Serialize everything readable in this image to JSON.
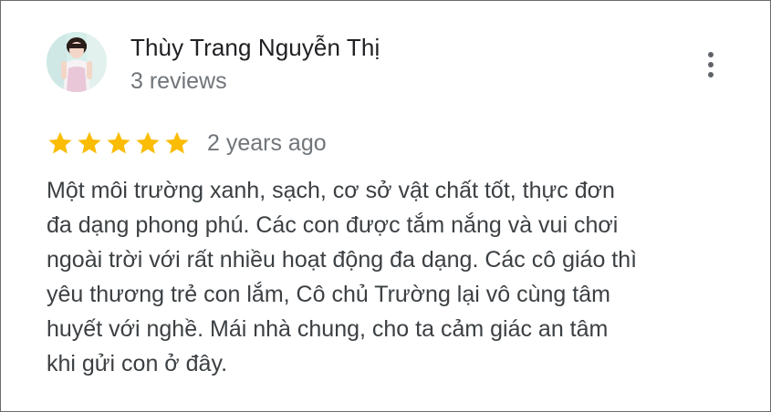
{
  "reviewer": {
    "name": "Thùy Trang Nguyễn Thị",
    "review_count": "3 reviews",
    "avatar_icon": "user-photo"
  },
  "menu": {
    "icon": "more-vertical-icon"
  },
  "review": {
    "rating": 5,
    "max_rating": 5,
    "star_color": "#fbbc04",
    "date": "2 years ago",
    "text_lines": [
      "Một môi trường xanh, sạch, cơ sở vật chất tốt, thực đơn",
      "đa dạng phong phú. Các con được tắm nắng và vui chơi",
      "ngoài trời với rất nhiều hoạt động đa dạng. Các cô giáo thì",
      "yêu thương trẻ con lắm, Cô chủ Trường lại vô cùng tâm",
      "huyết với nghề. Mái nhà chung, cho ta cảm giác an tâm",
      "khi gửi con ở đây."
    ]
  }
}
